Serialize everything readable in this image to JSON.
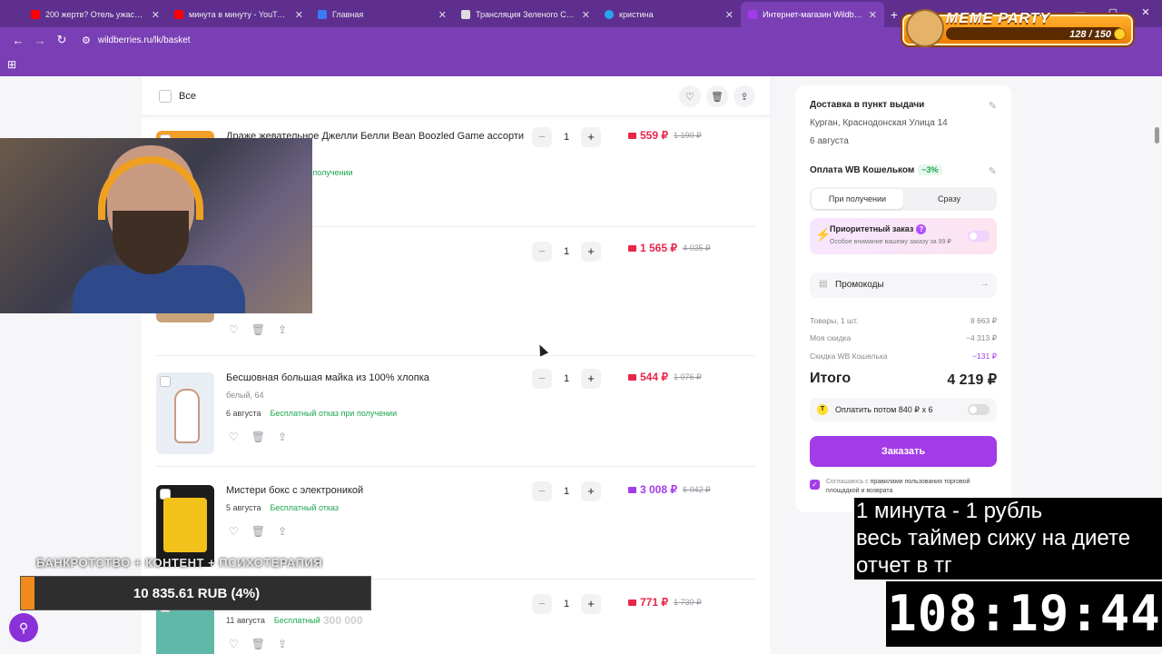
{
  "browser": {
    "tabs": [
      {
        "title": "200 жертв? Отель ужаса? Пер",
        "favicon_color": "#ff0000"
      },
      {
        "title": "минута в минуту - YouTube",
        "favicon_color": "#ff0000"
      },
      {
        "title": "Главная",
        "favicon_color": "#3b7bf6"
      },
      {
        "title": "Трансляция Зеленого Слоник",
        "favicon_color": "#dddddd"
      },
      {
        "title": "кристина",
        "favicon_color": "#2aa3ef"
      },
      {
        "title": "Интернет-магазин Wildberries",
        "favicon_color": "#a23be8"
      }
    ],
    "url": "wildberries.ru/lk/basket"
  },
  "meme_party": {
    "title": "MEME PARTY",
    "count": "128 / 150"
  },
  "basket": {
    "select_all_label": "Все",
    "items": [
      {
        "name": "Драже жевательное Джелли Белли Bean Boozled Game ассорти",
        "attr": "",
        "date": "",
        "return": "Бесплатный отказ при получении",
        "qty": "1",
        "price": "559 ₽",
        "old_price": "1 190 ₽",
        "wallet_color": "#e8264a",
        "thumb_color": "#f2a02a"
      },
      {
        "name": "",
        "attr": "",
        "date": "",
        "return": "",
        "qty": "1",
        "price": "1 565 ₽",
        "old_price": "4 035 ₽",
        "wallet_color": "#e8264a",
        "thumb_color": "#c9a47a"
      },
      {
        "name": "Бесшовная большая майка из 100% хлопка",
        "attr": "белый, 64",
        "date": "6 августа",
        "return": "Бесплатный отказ при получении",
        "qty": "1",
        "price": "544 ₽",
        "old_price": "1 076 ₽",
        "wallet_color": "#e8264a",
        "thumb_color": "#e9eef4"
      },
      {
        "name": "Мистери бокс с электроникой",
        "attr": "",
        "date": "5 августа",
        "return": "Бесплатный отказ",
        "qty": "1",
        "price": "3 008 ₽",
        "old_price": "6 042 ₽",
        "wallet_color": "#a23be8",
        "thumb_color": "#1c1c1c"
      },
      {
        "name": "",
        "attr": "",
        "date": "11 августа",
        "return": "Бесплатный",
        "qty": "1",
        "price": "771 ₽",
        "old_price": "1 730 ₽",
        "wallet_color": "#e8264a",
        "thumb_color": "#5fb8a8"
      }
    ]
  },
  "sidebar": {
    "delivery_title": "Доставка в пункт выдачи",
    "address": "Курган, Краснодонская Улица 14",
    "delivery_date": "6 августа",
    "payment_title": "Оплата WB Кошельком",
    "payment_discount": "−3%",
    "pay_on_receipt": "При получении",
    "pay_now": "Сразу",
    "priority_title": "Приоритетный заказ",
    "priority_sub": "Особое внимание вашему заказу за 99 ₽",
    "promocodes": "Промокоды",
    "goods_label": "Товары, 1 шт.",
    "goods_value": "8 663 ₽",
    "my_discount_label": "Моя скидка",
    "my_discount_value": "−4 313 ₽",
    "wallet_discount_label": "Скидка WB Кошелька",
    "wallet_discount_value": "−131 ₽",
    "total_label": "Итого",
    "total_value": "4 219 ₽",
    "pay_later": "Оплатить потом 840 ₽ x 6",
    "order_button": "Заказать",
    "agree_prefix": "Соглашаюсь с",
    "agree_link": "правилами пользования торговой площадкой и возврата"
  },
  "stream": {
    "banner": "БАНКРОТСТВО + КОНТЕНТ + ПСИХОТЕРАПИЯ",
    "donation": "10 835.61 RUB (4%)",
    "donation_percent": 4,
    "goal": "300 000",
    "caption_line1": "1 минута - 1 рубль",
    "caption_line2": "весь таймер сижу на диете",
    "caption_line3": "отчет в тг",
    "timer": "108:19:44"
  }
}
